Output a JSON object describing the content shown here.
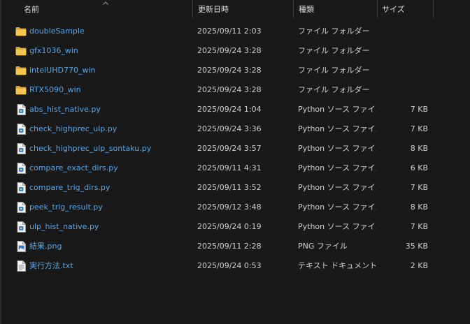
{
  "columns": {
    "name": "名前",
    "date": "更新日時",
    "type": "種類",
    "size": "サイズ"
  },
  "colors": {
    "background": "#191919",
    "name_text": "#5aa6e6",
    "folder": "#f2c14e",
    "py_file": "#4b8fd8"
  },
  "rows": [
    {
      "icon": "folder-icon",
      "name": "doubleSample",
      "date": "2025/09/11 2:03",
      "type": "ファイル フォルダー",
      "size": ""
    },
    {
      "icon": "folder-icon",
      "name": "gfx1036_win",
      "date": "2025/09/24 3:28",
      "type": "ファイル フォルダー",
      "size": ""
    },
    {
      "icon": "folder-icon",
      "name": "intelUHD770_win",
      "date": "2025/09/24 3:28",
      "type": "ファイル フォルダー",
      "size": ""
    },
    {
      "icon": "folder-icon",
      "name": "RTX5090_win",
      "date": "2025/09/24 3:28",
      "type": "ファイル フォルダー",
      "size": ""
    },
    {
      "icon": "python-file-icon",
      "name": "abs_hist_native.py",
      "date": "2025/09/24 1:04",
      "type": "Python ソース ファイル",
      "size": "7 KB"
    },
    {
      "icon": "python-file-icon",
      "name": "check_highprec_ulp.py",
      "date": "2025/09/24 3:36",
      "type": "Python ソース ファイル",
      "size": "7 KB"
    },
    {
      "icon": "python-file-icon",
      "name": "check_highprec_ulp_sontaku.py",
      "date": "2025/09/24 3:57",
      "type": "Python ソース ファイル",
      "size": "8 KB"
    },
    {
      "icon": "python-file-icon",
      "name": "compare_exact_dirs.py",
      "date": "2025/09/11 4:31",
      "type": "Python ソース ファイル",
      "size": "6 KB"
    },
    {
      "icon": "python-file-icon",
      "name": "compare_trig_dirs.py",
      "date": "2025/09/11 3:52",
      "type": "Python ソース ファイル",
      "size": "7 KB"
    },
    {
      "icon": "python-file-icon",
      "name": "peek_trig_result.py",
      "date": "2025/09/12 3:48",
      "type": "Python ソース ファイル",
      "size": "8 KB"
    },
    {
      "icon": "python-file-icon",
      "name": "ulp_hist_native.py",
      "date": "2025/09/24 0:19",
      "type": "Python ソース ファイル",
      "size": "7 KB"
    },
    {
      "icon": "image-file-icon",
      "name": "結果.png",
      "date": "2025/09/11 2:28",
      "type": "PNG ファイル",
      "size": "35 KB"
    },
    {
      "icon": "text-file-icon",
      "name": "実行方法.txt",
      "date": "2025/09/24 0:53",
      "type": "テキスト ドキュメント",
      "size": "2 KB"
    }
  ]
}
